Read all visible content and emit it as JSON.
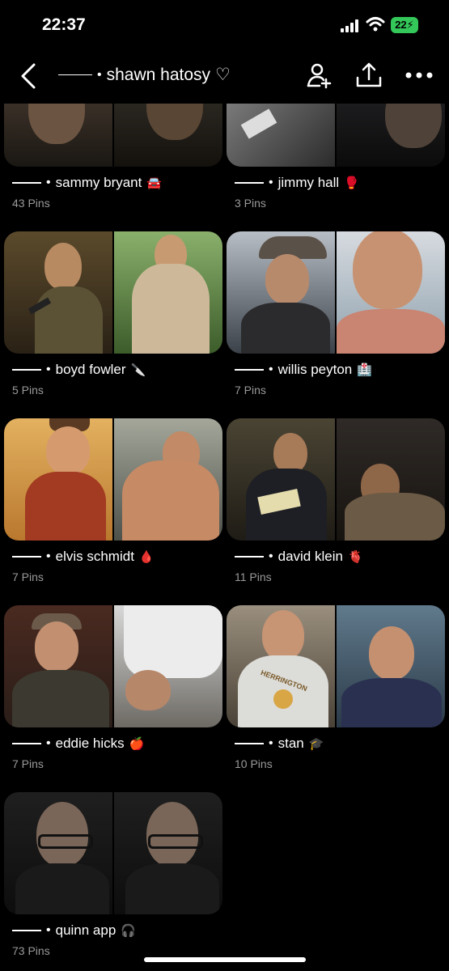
{
  "status": {
    "time": "22:37",
    "battery": "22"
  },
  "header": {
    "title": "shawn hatosy",
    "heart": "♡"
  },
  "boards": [
    {
      "name": "sammy bryant",
      "emoji": "🚘",
      "pins": "43 Pins"
    },
    {
      "name": "jimmy hall",
      "emoji": "🥊",
      "pins": "3 Pins"
    },
    {
      "name": "boyd fowler",
      "emoji": "🔪",
      "pins": "5 Pins"
    },
    {
      "name": "willis peyton",
      "emoji": "🏥",
      "pins": "7 Pins"
    },
    {
      "name": "elvis schmidt",
      "emoji": "🩸",
      "pins": "7 Pins"
    },
    {
      "name": "david klein",
      "emoji": "🫀",
      "pins": "11 Pins"
    },
    {
      "name": "eddie hicks",
      "emoji": "🍎",
      "pins": "7 Pins"
    },
    {
      "name": "stan",
      "emoji": "🎓",
      "pins": "10 Pins"
    },
    {
      "name": "quinn app",
      "emoji": "🎧",
      "pins": "73 Pins"
    }
  ],
  "shirt_text": "HERRINGTON",
  "icons": [
    "back-chevron-icon",
    "add-collaborator-icon",
    "share-icon",
    "more-icon",
    "signal-icon",
    "wifi-icon",
    "battery-icon"
  ]
}
